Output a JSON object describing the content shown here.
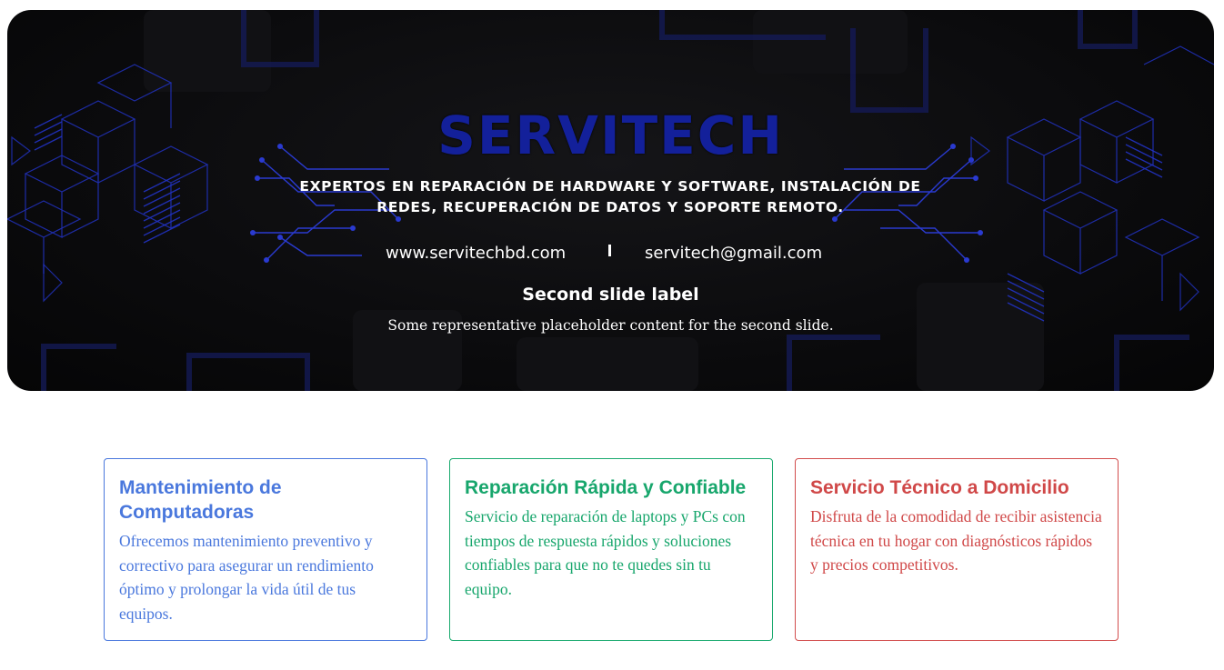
{
  "hero": {
    "brand": "SERVITECH",
    "tagline": "EXPERTOS EN REPARACIÓN DE HARDWARE Y SOFTWARE, INSTALACIÓN DE REDES, RECUPERACIÓN DE DATOS Y SOPORTE REMOTO.",
    "website": "www.servitechbd.com",
    "email": "servitech@gmail.com",
    "slide_label": "Second slide label",
    "slide_text": "Some representative placeholder content for the second slide."
  },
  "cards": [
    {
      "title": "Mantenimiento de Computadoras",
      "text": "Ofrecemos mantenimiento preventivo y correctivo para asegurar un rendimiento óptimo y prolongar la vida útil de tus equipos.",
      "color": "#4a78dd"
    },
    {
      "title": "Reparación Rápida y Confiable",
      "text": "Servicio de reparación de laptops y PCs con tiempos de respuesta rápidos y soluciones confiables para que no te quedes sin tu equipo.",
      "color": "#17a66c"
    },
    {
      "title": "Servicio Técnico a Domicilio",
      "text": "Disfruta de la comodidad de recibir asistencia técnica en tu hogar con diagnósticos rápidos y precios competitivos.",
      "color": "#d04848"
    }
  ],
  "colors": {
    "hero_background": "#0b0b0d",
    "brand_blue": "#13209a",
    "circuit_blue": "#1f2fb8"
  }
}
